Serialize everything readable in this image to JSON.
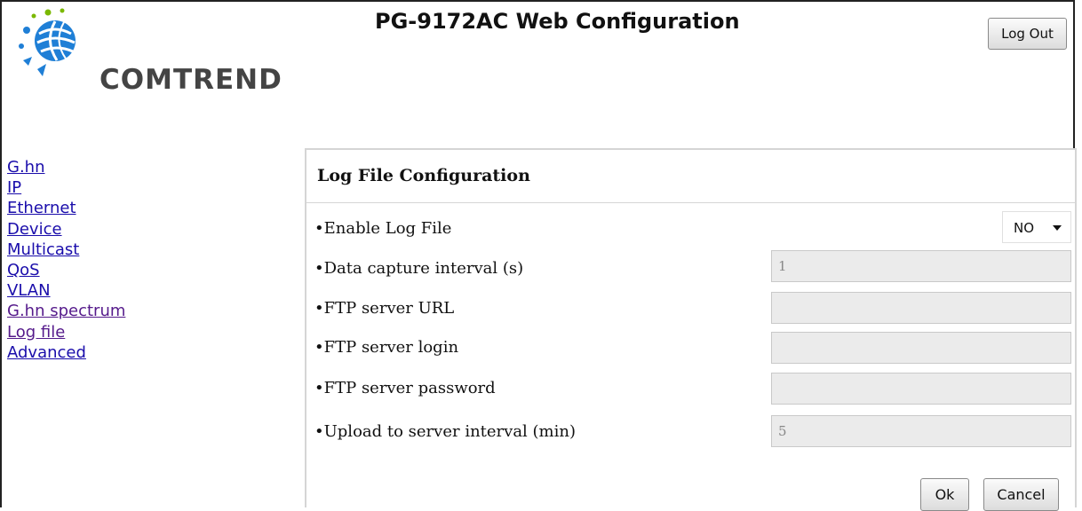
{
  "header": {
    "title": "PG-9172AC Web Configuration",
    "brand": "COMTREND",
    "logout_label": "Log Out"
  },
  "nav": {
    "items": [
      {
        "label": "G.hn"
      },
      {
        "label": "IP"
      },
      {
        "label": "Ethernet"
      },
      {
        "label": "Device"
      },
      {
        "label": "Multicast"
      },
      {
        "label": "QoS"
      },
      {
        "label": "VLAN"
      },
      {
        "label": "G.hn spectrum"
      },
      {
        "label": "Log file"
      },
      {
        "label": "Advanced"
      }
    ]
  },
  "panel": {
    "title": "Log File Configuration",
    "enable_label": "•Enable Log File",
    "enable_value": "NO",
    "interval_label": "•Data capture interval (s)",
    "interval_value": "1",
    "ftp_url_label": "•FTP server URL",
    "ftp_url_value": "",
    "ftp_login_label": "•FTP server login",
    "ftp_login_value": "",
    "ftp_password_label": "•FTP server password",
    "ftp_password_value": "",
    "upload_label": "•Upload to server interval (min)",
    "upload_value": "5",
    "ok_label": "Ok",
    "cancel_label": "Cancel"
  },
  "colors": {
    "link": "#1a0dab",
    "visited_link": "#551a8b",
    "logo_blue": "#1f7fd6",
    "logo_green": "#7ab800",
    "field_disabled_bg": "#ebebeb"
  },
  "icons": {
    "logo": "comtrend-globe-logo",
    "select_caret": "chevron-down-icon"
  }
}
